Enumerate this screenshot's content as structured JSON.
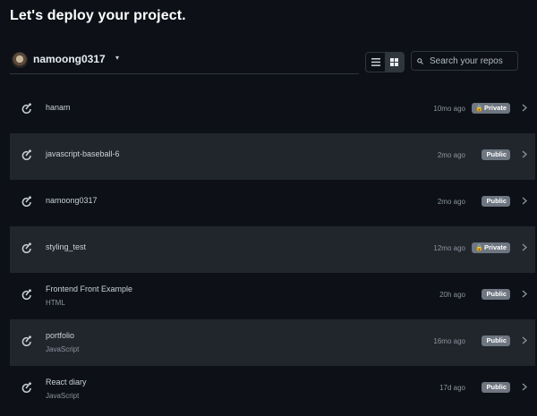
{
  "header": {
    "title": "Let's deploy your project."
  },
  "account": {
    "name": "namoong0317",
    "caret": "▾"
  },
  "view_toggle": {
    "icons": [
      "list-icon",
      "grid-icon"
    ],
    "active": "grid-icon"
  },
  "search": {
    "placeholder": "Search your repos"
  },
  "repos": [
    {
      "name": "hanam",
      "subtitle": "",
      "time": "10mo ago",
      "visibility": "Private",
      "lock": "🔒"
    },
    {
      "name": "javascript-baseball-6",
      "subtitle": "",
      "time": "2mo ago",
      "visibility": "Public",
      "lock": ""
    },
    {
      "name": "namoong0317",
      "subtitle": "",
      "time": "2mo ago",
      "visibility": "Public",
      "lock": ""
    },
    {
      "name": "styling_test",
      "subtitle": "",
      "time": "12mo ago",
      "visibility": "Private",
      "lock": "🔒"
    },
    {
      "name": "Frontend Front Example",
      "subtitle": "HTML",
      "time": "20h ago",
      "visibility": "Public",
      "lock": ""
    },
    {
      "name": "portfolio",
      "subtitle": "JavaScript",
      "time": "16mo ago",
      "visibility": "Public",
      "lock": ""
    },
    {
      "name": "React diary",
      "subtitle": "JavaScript",
      "time": "17d ago",
      "visibility": "Public",
      "lock": ""
    }
  ],
  "colors": {
    "background": "#0d1117",
    "row_alt": "#21262d",
    "badge": "#6e7681",
    "muted_text": "#8b949e"
  }
}
